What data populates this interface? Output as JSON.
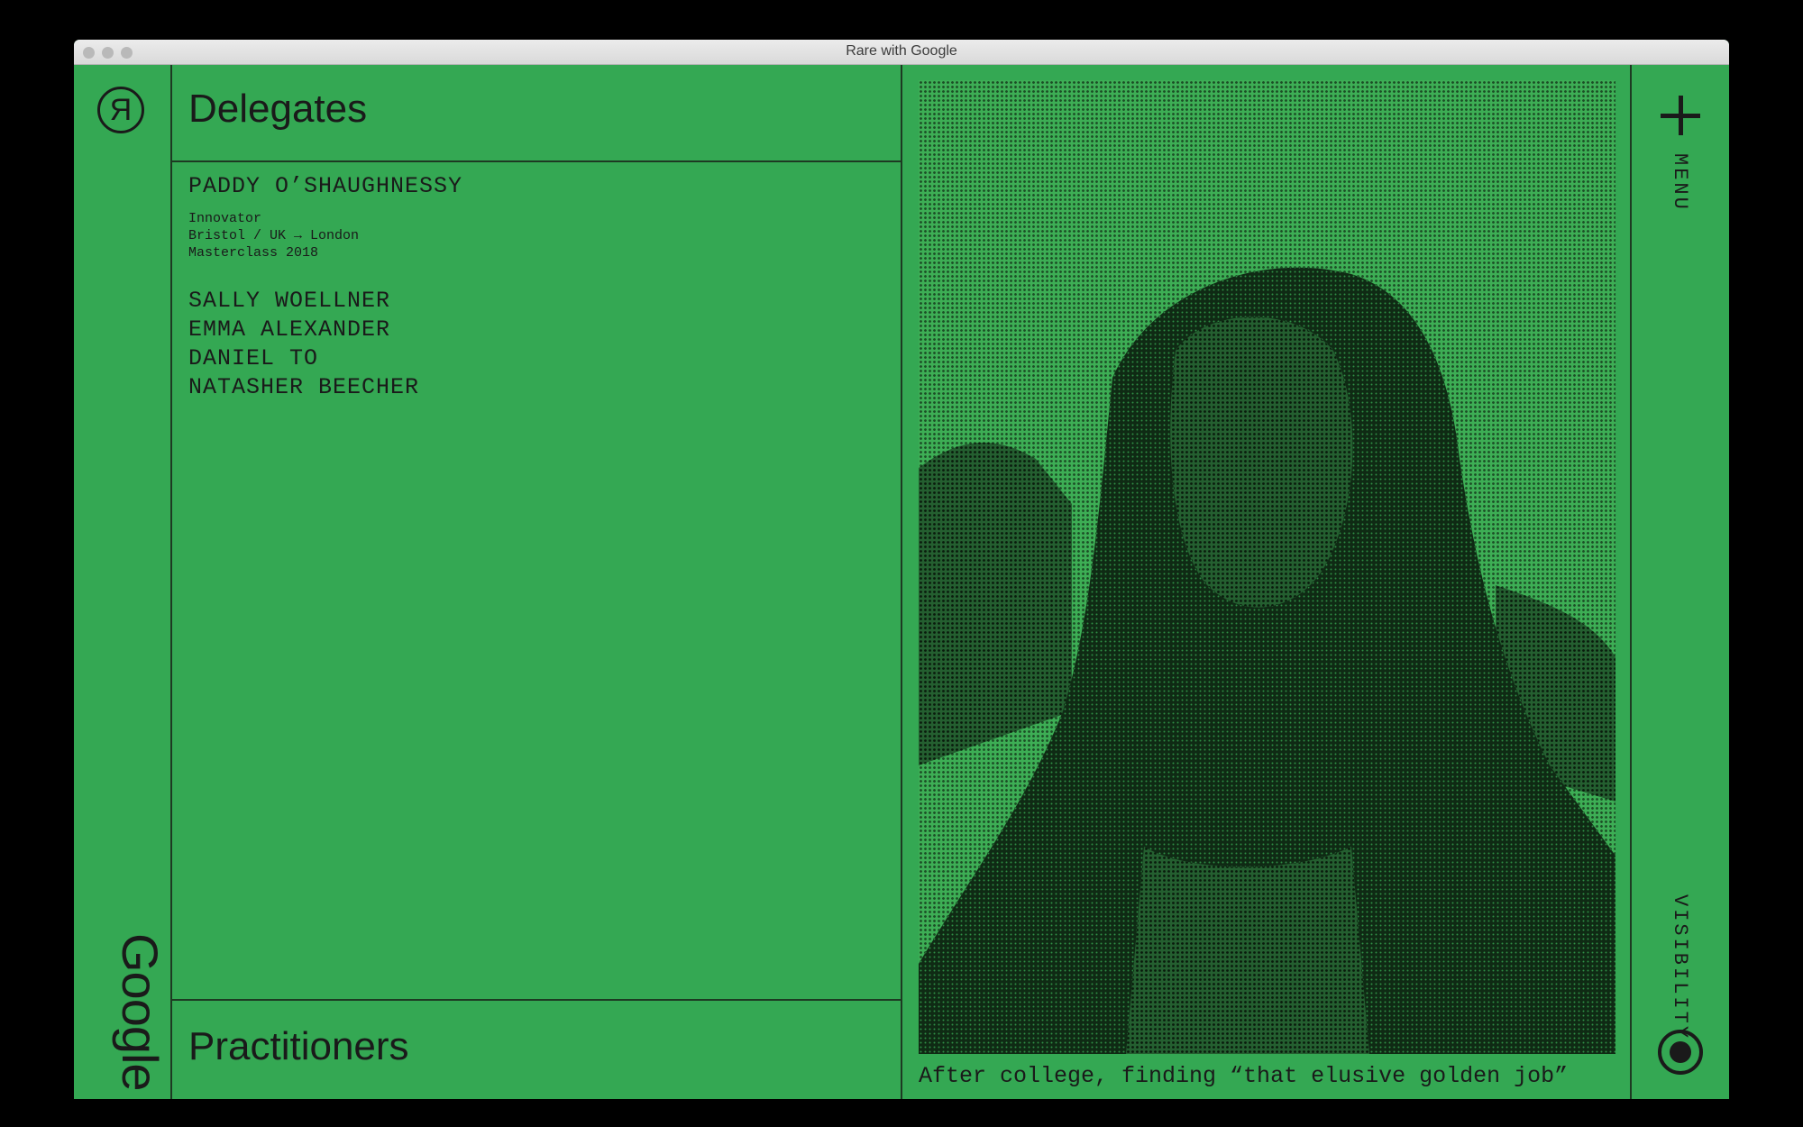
{
  "window": {
    "title": "Rare with Google"
  },
  "brand": {
    "logo_letter": "R",
    "google_label": "Google"
  },
  "sections": {
    "delegates_title": "Delegates",
    "practitioners_title": "Practitioners"
  },
  "featured": {
    "name": "PADDY O’SHAUGHNESSY",
    "role": "Innovator",
    "location": "Bristol / UK → London",
    "program": "Masterclass 2018"
  },
  "delegates": [
    {
      "name": "SALLY WOELLNER"
    },
    {
      "name": "EMMA ALEXANDER"
    },
    {
      "name": "DANIEL TO"
    },
    {
      "name": "NATASHER BEECHER"
    }
  ],
  "caption": "After college, finding “that elusive golden job”",
  "rail": {
    "menu_label": "MENU",
    "visibility_label": "VISIBILITY"
  },
  "icons": {
    "logo": "r-circle-logo-icon",
    "menu": "plus-icon",
    "visibility": "target-circle-icon"
  },
  "colors": {
    "background": "#34a853",
    "ink": "#1a1a1a"
  }
}
